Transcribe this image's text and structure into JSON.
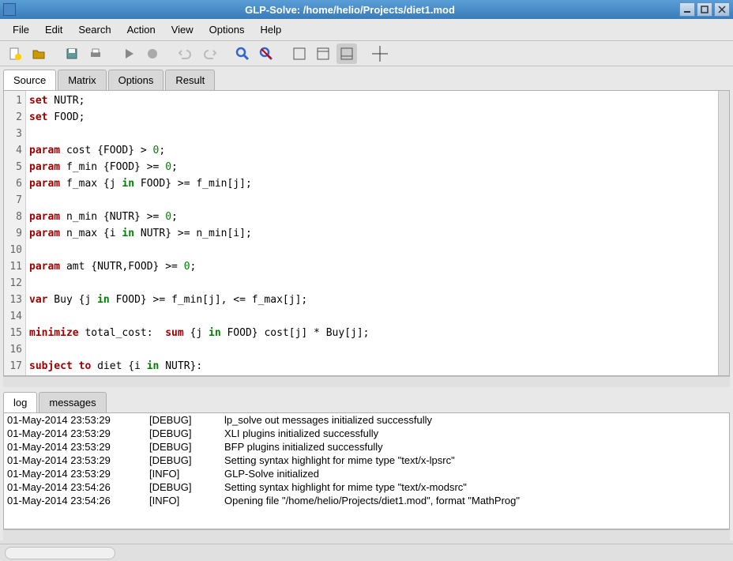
{
  "window": {
    "title": "GLP-Solve: /home/helio/Projects/diet1.mod"
  },
  "menu": {
    "file": "File",
    "edit": "Edit",
    "search": "Search",
    "action": "Action",
    "view": "View",
    "options": "Options",
    "help": "Help"
  },
  "tabs": {
    "source": "Source",
    "matrix": "Matrix",
    "options": "Options",
    "result": "Result"
  },
  "code": {
    "lines": [
      "1",
      "2",
      "3",
      "4",
      "5",
      "6",
      "7",
      "8",
      "9",
      "10",
      "11",
      "12",
      "13",
      "14",
      "15",
      "16",
      "17"
    ],
    "l1a": "set",
    "l1b": " NUTR;",
    "l2a": "set",
    "l2b": " FOOD;",
    "l4a": "param",
    "l4b": " cost {FOOD} > ",
    "l4c": "0",
    "l4d": ";",
    "l5a": "param",
    "l5b": " f_min {FOOD} >= ",
    "l5c": "0",
    "l5d": ";",
    "l6a": "param",
    "l6b": " f_max {j ",
    "l6c": "in",
    "l6d": " FOOD} >= f_min[j];",
    "l8a": "param",
    "l8b": " n_min {NUTR} >= ",
    "l8c": "0",
    "l8d": ";",
    "l9a": "param",
    "l9b": " n_max {i ",
    "l9c": "in",
    "l9d": " NUTR} >= n_min[i];",
    "l11a": "param",
    "l11b": " amt {NUTR,FOOD} >= ",
    "l11c": "0",
    "l11d": ";",
    "l13a": "var",
    "l13b": " Buy {j ",
    "l13c": "in",
    "l13d": " FOOD} >= f_min[j], <= f_max[j];",
    "l15a": "minimize",
    "l15b": " total_cost:  ",
    "l15c": "sum",
    "l15d": " {j ",
    "l15e": "in",
    "l15f": " FOOD} cost[j] * Buy[j];",
    "l17a": "subject to",
    "l17b": " diet {i ",
    "l17c": "in",
    "l17d": " NUTR}:"
  },
  "bottom_tabs": {
    "log": "log",
    "messages": "messages"
  },
  "log": [
    {
      "date": "01-May-2014  23:53:29",
      "level": "[DEBUG]",
      "msg": "lp_solve out messages initialized successfully"
    },
    {
      "date": "01-May-2014  23:53:29",
      "level": "[DEBUG]",
      "msg": "XLI plugins initialized successfully"
    },
    {
      "date": "01-May-2014  23:53:29",
      "level": "[DEBUG]",
      "msg": "BFP plugins initialized successfully"
    },
    {
      "date": "01-May-2014  23:53:29",
      "level": "[DEBUG]",
      "msg": "Setting syntax highlight for mime type \"text/x-lpsrc\""
    },
    {
      "date": "01-May-2014  23:53:29",
      "level": "[INFO]",
      "msg": "GLP-Solve initialized"
    },
    {
      "date": "01-May-2014  23:54:26",
      "level": "[DEBUG]",
      "msg": "Setting syntax highlight for mime type \"text/x-modsrc\""
    },
    {
      "date": "01-May-2014  23:54:26",
      "level": "[INFO]",
      "msg": "Opening file \"/home/helio/Projects/diet1.mod\", format \"MathProg\""
    }
  ]
}
